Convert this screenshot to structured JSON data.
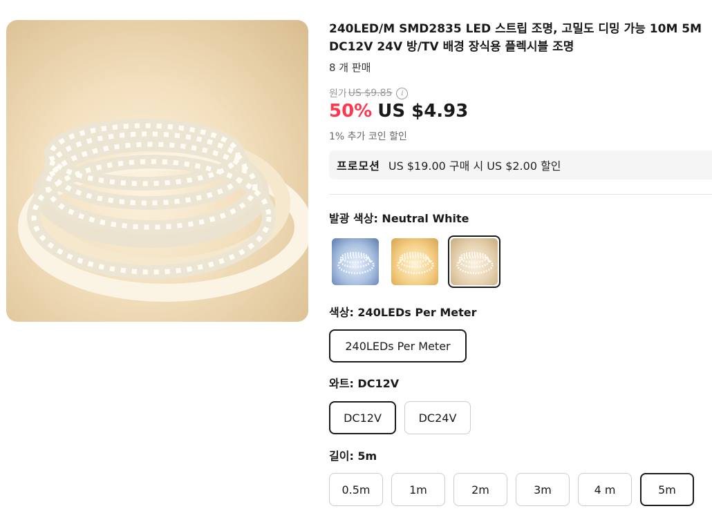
{
  "product": {
    "title": "240LED/M SMD2835 LED 스트립 조명, 고밀도 디밍 가능 10M 5M DC12V 24V 방/TV 배경 장식용 플렉시블 조명",
    "sold": "8 개 판매",
    "original_label": "원가",
    "original_price": "US $9.85",
    "info_icon": "i",
    "discount": "50%",
    "price": "US $4.93",
    "coin_note": "1% 추가 코인 할인"
  },
  "promo": {
    "label": "프로모션",
    "text": "US $19.00 구매 시 US $2.00 할인"
  },
  "colors": {
    "accent_red": "#fd384f",
    "selected_border": "#191919"
  },
  "options": {
    "light_color": {
      "label": "발광 색상: ",
      "value": "Neutral White",
      "swatches": [
        "cool-white-strip-icon",
        "warm-white-strip-icon",
        "neutral-white-strip-icon"
      ],
      "selected_index": 2
    },
    "color": {
      "label": "색상: ",
      "value": "240LEDs Per Meter",
      "choices": [
        "240LEDs Per Meter"
      ]
    },
    "watt": {
      "label": "와트: ",
      "value": "DC12V",
      "choices": [
        "DC12V",
        "DC24V"
      ]
    },
    "length": {
      "label": "길이: ",
      "value": "5m",
      "choices": [
        "0.5m",
        "1m",
        "2m",
        "3m",
        "4 m",
        "5m"
      ]
    }
  }
}
